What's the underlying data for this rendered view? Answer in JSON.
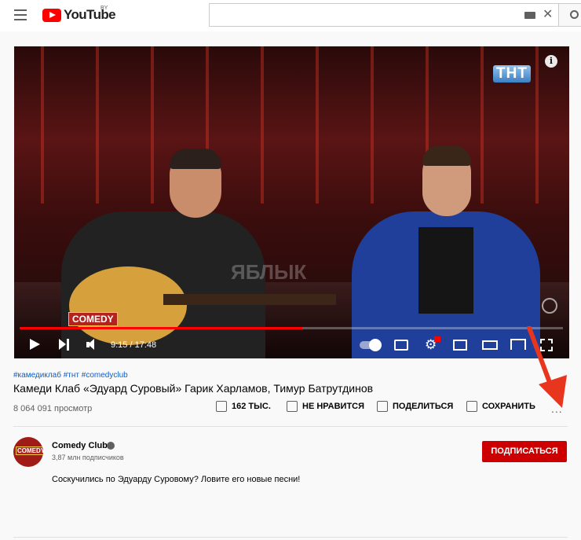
{
  "header": {
    "logo_text": "YouTube",
    "logo_country": "BY",
    "search": {
      "value": "",
      "placeholder": ""
    }
  },
  "player": {
    "channel_watermark": "ТНТ",
    "show_logo": "COMEDY",
    "watermark_text": "ЯБЛЫК",
    "time_display": "9:15 / 17:48",
    "progress_fraction": 0.52,
    "info_icon": "i"
  },
  "video": {
    "hashtags": "#камедиклаб #тнт #comedyclub",
    "title": "Камеди Клаб «Эдуард Суровый» Гарик Харламов, Тимур Батрутдинов",
    "views": "8 064 091 просмотр",
    "actions": {
      "like": "162 ТЫС.",
      "dislike": "НЕ НРАВИТСЯ",
      "share": "ПОДЕЛИТЬСЯ",
      "save": "СОХРАНИТЬ",
      "more": "..."
    }
  },
  "channel": {
    "avatar_text": "COMEDY",
    "name": "Comedy Club",
    "subscribers": "3,87 млн подписчиков",
    "subscribe_label": "ПОДПИСАТЬСЯ"
  },
  "description": "Соскучились по Эдуарду Суровому? Ловите его новые песни!",
  "colors": {
    "brand_red": "#ff0000",
    "subscribe_red": "#cc0000",
    "link_blue": "#065fd4",
    "arrow_red": "#e8351e"
  }
}
